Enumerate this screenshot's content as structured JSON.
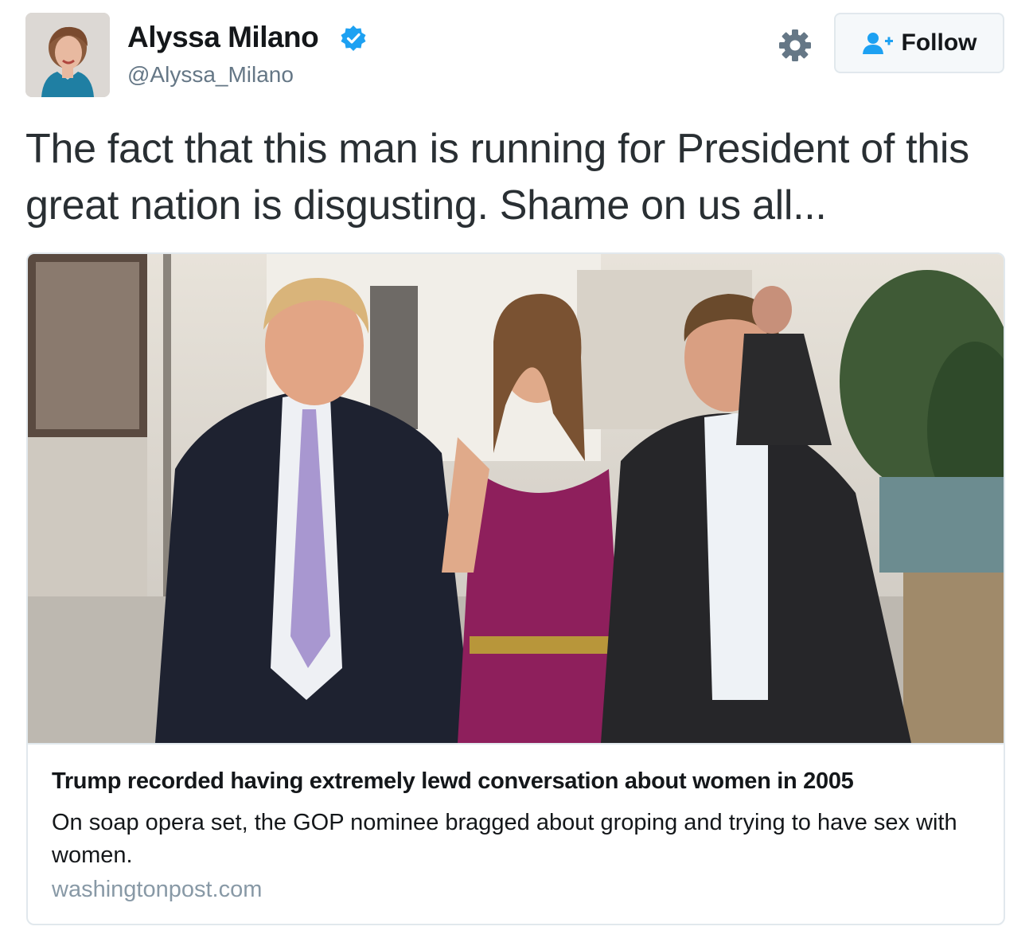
{
  "author": {
    "name": "Alyssa Milano",
    "handle": "@Alyssa_Milano",
    "verified": true,
    "avatar_icon": "profile-photo"
  },
  "actions": {
    "settings_icon": "gear-icon",
    "follow_label": "Follow",
    "follow_icon": "add-user-icon"
  },
  "tweet": {
    "text": "The fact that this man is running for President of this great nation is disgusting. Shame on us all..."
  },
  "card": {
    "image_icon": "article-photo",
    "title": "Trump recorded having extremely lewd conversation about women in 2005",
    "description": "On soap opera set, the GOP nominee bragged about groping and trying to have sex with women.",
    "domain": "washingtonpost.com"
  },
  "colors": {
    "verified_blue": "#1da1f2",
    "text_primary": "#14171a",
    "text_secondary": "#657786",
    "border": "#e1e8ed"
  }
}
